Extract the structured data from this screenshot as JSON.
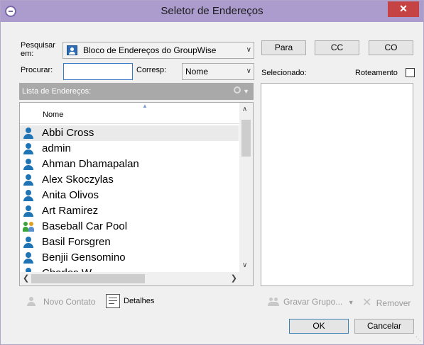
{
  "window": {
    "title": "Seletor de Endereços",
    "close_glyph": "✕"
  },
  "search": {
    "label": "Pesquisar em:",
    "book_value": "Bloco de Endereços do GroupWise",
    "find_label": "Procurar:",
    "find_value": "",
    "match_label": "Corresp:",
    "match_value": "Nome"
  },
  "address_list": {
    "header": "Lista de Endereços:",
    "column_name": "Nome",
    "rows": [
      {
        "name": "Abbi Cross",
        "type": "user",
        "selected": true
      },
      {
        "name": "admin",
        "type": "user"
      },
      {
        "name": "Ahman Dhamapalan",
        "type": "user"
      },
      {
        "name": "Alex Skoczylas",
        "type": "user"
      },
      {
        "name": "Anita Olivos",
        "type": "user"
      },
      {
        "name": "Art Ramirez",
        "type": "user"
      },
      {
        "name": "Baseball Car Pool",
        "type": "group"
      },
      {
        "name": "Basil Forsgren",
        "type": "user"
      },
      {
        "name": "Benjii Gensomino",
        "type": "user"
      },
      {
        "name": "Charles W...",
        "type": "user"
      }
    ]
  },
  "recipients": {
    "to_label": "Para",
    "cc_label": "CC",
    "bc_label": "CO",
    "selected_label": "Selecionado:",
    "routing_label": "Roteamento",
    "routing_checked": false
  },
  "toolbar": {
    "new_contact": "Novo Contato",
    "details": "Detalhes",
    "save_group": "Gravar Grupo...",
    "remove": "Remover"
  },
  "buttons": {
    "ok": "OK",
    "cancel": "Cancelar"
  },
  "colors": {
    "titlebar": "#ab9ccd",
    "close": "#c64343",
    "user_icon": "#1f74b5",
    "list_header": "#a9a9a9"
  }
}
